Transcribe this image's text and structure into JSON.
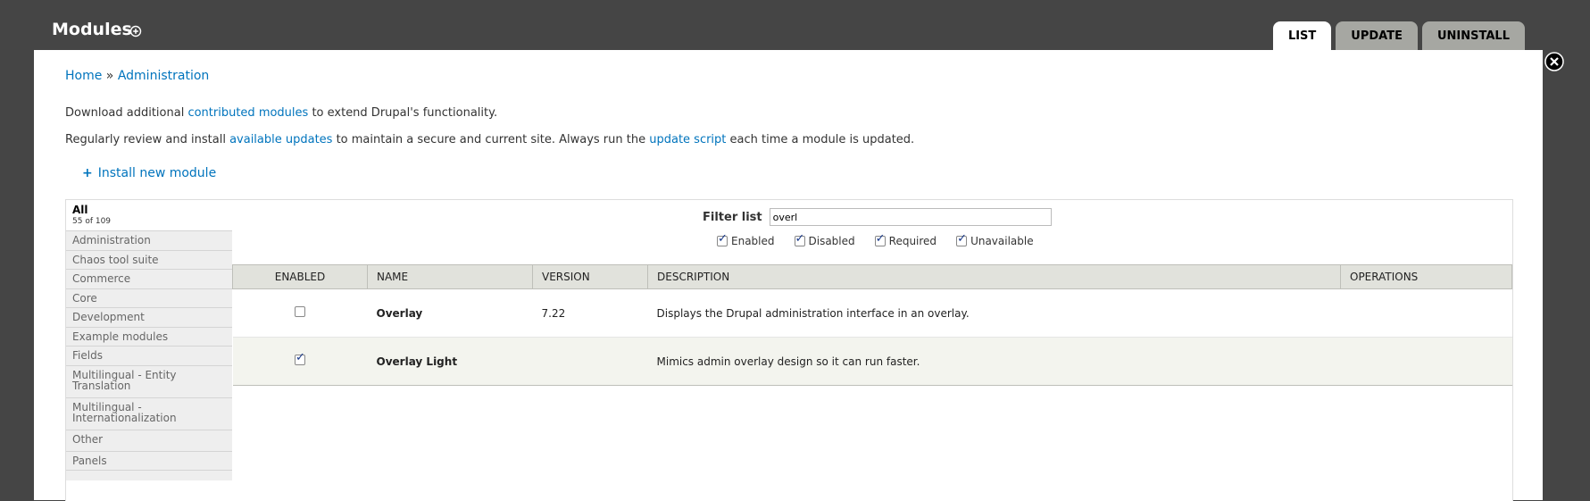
{
  "header": {
    "title": "Modules",
    "tabs": [
      {
        "label": "List",
        "active": true
      },
      {
        "label": "Update",
        "active": false
      },
      {
        "label": "Uninstall",
        "active": false
      }
    ]
  },
  "breadcrumb": {
    "home": "Home",
    "sep": "»",
    "admin": "Administration"
  },
  "help": {
    "line1_a": "Download additional ",
    "line1_link": "contributed modules",
    "line1_b": " to extend Drupal's functionality.",
    "line2_a": "Regularly review and install ",
    "line2_link1": "available updates",
    "line2_b": " to maintain a secure and current site. Always run the ",
    "line2_link2": "update script",
    "line2_c": " each time a module is updated."
  },
  "install_link": {
    "icon": "+",
    "label": "Install new module"
  },
  "vertical_tabs": {
    "all_label": "All",
    "all_count": "55 of 109",
    "items": [
      "Administration",
      "Chaos tool suite",
      "Commerce",
      "Core",
      "Development",
      "Example modules",
      "Fields",
      "Multilingual - Entity Translation",
      "Multilingual - Internationalization",
      "Other",
      "Panels"
    ]
  },
  "filter": {
    "label": "Filter list",
    "value": "overl",
    "checkboxes": [
      {
        "label": "Enabled",
        "checked": true
      },
      {
        "label": "Disabled",
        "checked": true
      },
      {
        "label": "Required",
        "checked": true
      },
      {
        "label": "Unavailable",
        "checked": true
      }
    ]
  },
  "table": {
    "columns": [
      "Enabled",
      "Name",
      "Version",
      "Description",
      "Operations"
    ],
    "rows": [
      {
        "enabled": false,
        "name": "Overlay",
        "version": "7.22",
        "description": "Displays the Drupal administration interface in an overlay.",
        "operations": ""
      },
      {
        "enabled": true,
        "name": "Overlay Light",
        "version": "",
        "description": "Mimics admin overlay design so it can run faster.",
        "operations": ""
      }
    ]
  },
  "colors": {
    "background": "#454545",
    "link": "#0074bd",
    "tab_inactive": "#a6a7a2",
    "table_header": "#e1e2dc"
  }
}
